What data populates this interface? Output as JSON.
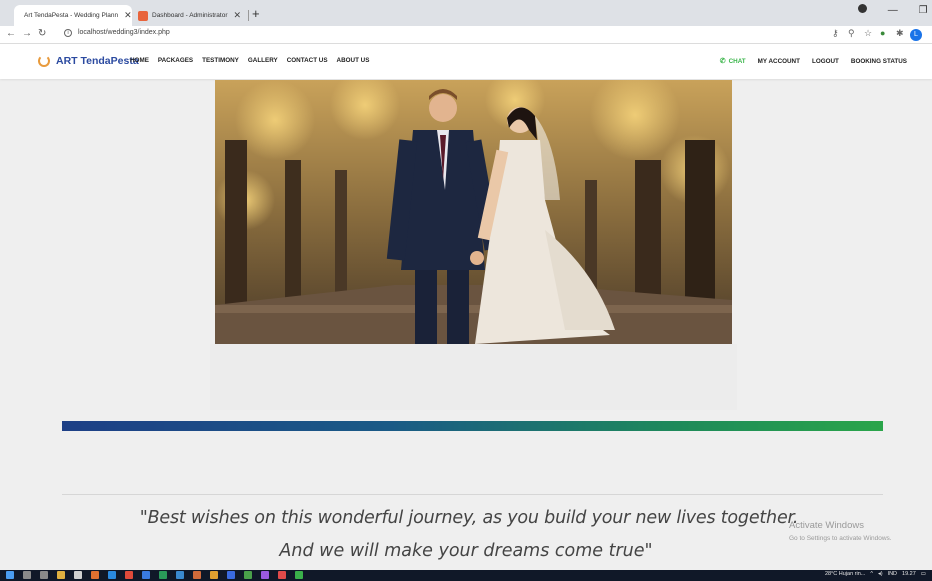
{
  "browser": {
    "tabs": [
      {
        "title": "Art TendaPesta - Wedding Plann",
        "close": "✕",
        "active": true
      },
      {
        "title": "Dashboard - Administrator",
        "close": "✕",
        "active": false
      }
    ],
    "new_tab": "+",
    "url": "localhost/wedding3/index.php",
    "profile_initial": "L"
  },
  "site": {
    "brand": "ART TendaPesta",
    "nav": [
      "HOME",
      "PACKAGES",
      "TESTIMONY",
      "GALLERY",
      "CONTACT US",
      "ABOUT US"
    ],
    "right_nav": {
      "chat": "CHAT",
      "my_account": "MY ACCOUNT",
      "logout": "LOGOUT",
      "booking_status": "BOOKING STATUS"
    }
  },
  "quote": {
    "line1": "\"Best wishes on this wonderful journey, as you build your new lives together.",
    "line2": "And we will make your dreams come true\""
  },
  "watermark": {
    "title": "Activate Windows",
    "subtitle": "Go to Settings to activate Windows."
  },
  "taskbar": {
    "weather": "28°C  Hujan rin...",
    "lang": "IND",
    "time": "19.27"
  },
  "colors": {
    "brand": "#2b4aa0",
    "chat": "#3ab54a",
    "bar_start": "#1d3f86",
    "bar_end": "#2aa54a"
  }
}
